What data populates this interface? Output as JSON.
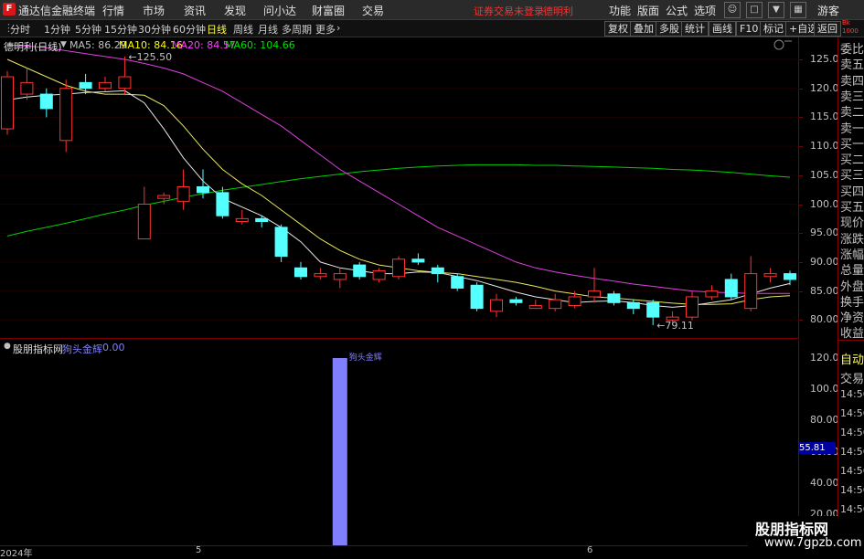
{
  "titlebar": {
    "logo": "F",
    "app_title": "通达信金融终端",
    "menus": [
      "行情",
      "市场",
      "资讯",
      "发现",
      "问小达",
      "财富圈",
      "交易"
    ],
    "login_notice": "证券交易未登录",
    "stock_name": "德明利",
    "right_menus": [
      "功能",
      "版面",
      "公式",
      "选项"
    ],
    "guest": "游客"
  },
  "toolbar": {
    "periods": [
      "分时",
      "1分钟",
      "5分钟",
      "15分钟",
      "30分钟",
      "60分钟",
      "日线",
      "周线",
      "月线",
      "多周期",
      "更多"
    ],
    "active_period": "日线",
    "buttons": [
      "复权",
      "叠加",
      "多股",
      "统计",
      "画线",
      "F10",
      "标记",
      "+自选",
      "返回"
    ]
  },
  "main_chart": {
    "title": "德明利(日线)",
    "ma_labels": [
      {
        "text": "MA5: 86.29",
        "color": "#ffffff"
      },
      {
        "text": "MA10: 84.16",
        "color": "#ffff00"
      },
      {
        "text": "MA20: 84.57",
        "color": "#ff40ff"
      },
      {
        "text": "MA60: 104.66",
        "color": "#00e000"
      }
    ],
    "high_label": "125.50",
    "low_label": "79.11",
    "y_ticks": [
      "125.0",
      "120.0",
      "115.0",
      "110.0",
      "105.0",
      "100.0",
      "95.00",
      "90.00",
      "85.00",
      "80.00"
    ]
  },
  "chart_data": {
    "type": "candlestick",
    "ylim": [
      78,
      128
    ],
    "candles": [
      {
        "o": 113.0,
        "c": 122.0,
        "h": 123.0,
        "l": 112.0
      },
      {
        "o": 119.0,
        "c": 121.0,
        "h": 123.5,
        "l": 118.0
      },
      {
        "o": 119.0,
        "c": 116.5,
        "h": 120.0,
        "l": 115.0
      },
      {
        "o": 111.0,
        "c": 120.0,
        "h": 121.5,
        "l": 109.0
      },
      {
        "o": 121.0,
        "c": 120.0,
        "h": 122.5,
        "l": 119.0
      },
      {
        "o": 120.0,
        "c": 121.0,
        "h": 122.0,
        "l": 119.5
      },
      {
        "o": 120.0,
        "c": 122.0,
        "h": 125.5,
        "l": 119.0
      },
      {
        "o": 94.0,
        "c": 100.0,
        "h": 103.0,
        "l": 94.0
      },
      {
        "o": 101.0,
        "c": 101.5,
        "h": 102.0,
        "l": 100.0
      },
      {
        "o": 100.5,
        "c": 103.0,
        "h": 106.0,
        "l": 99.0
      },
      {
        "o": 103.0,
        "c": 102.0,
        "h": 106.0,
        "l": 101.0
      },
      {
        "o": 102.0,
        "c": 98.0,
        "h": 103.0,
        "l": 97.5
      },
      {
        "o": 97.0,
        "c": 97.5,
        "h": 99.0,
        "l": 96.5
      },
      {
        "o": 97.5,
        "c": 97.0,
        "h": 98.0,
        "l": 96.0
      },
      {
        "o": 96.0,
        "c": 91.0,
        "h": 96.5,
        "l": 90.0
      },
      {
        "o": 89.0,
        "c": 87.5,
        "h": 90.0,
        "l": 87.0
      },
      {
        "o": 87.5,
        "c": 88.0,
        "h": 89.0,
        "l": 87.0
      },
      {
        "o": 87.0,
        "c": 88.0,
        "h": 89.0,
        "l": 85.5
      },
      {
        "o": 89.5,
        "c": 87.5,
        "h": 90.0,
        "l": 87.0
      },
      {
        "o": 87.0,
        "c": 88.5,
        "h": 89.0,
        "l": 86.5
      },
      {
        "o": 87.5,
        "c": 90.5,
        "h": 91.0,
        "l": 87.0
      },
      {
        "o": 90.5,
        "c": 90.0,
        "h": 91.5,
        "l": 89.5
      },
      {
        "o": 89.0,
        "c": 88.0,
        "h": 89.5,
        "l": 86.5
      },
      {
        "o": 87.5,
        "c": 85.5,
        "h": 88.0,
        "l": 85.0
      },
      {
        "o": 86.0,
        "c": 82.0,
        "h": 86.5,
        "l": 81.5
      },
      {
        "o": 81.5,
        "c": 83.5,
        "h": 84.5,
        "l": 80.5
      },
      {
        "o": 83.5,
        "c": 83.0,
        "h": 84.0,
        "l": 82.5
      },
      {
        "o": 82.0,
        "c": 82.5,
        "h": 83.5,
        "l": 82.0
      },
      {
        "o": 82.0,
        "c": 83.5,
        "h": 84.5,
        "l": 81.5
      },
      {
        "o": 82.5,
        "c": 84.0,
        "h": 85.0,
        "l": 82.0
      },
      {
        "o": 84.0,
        "c": 85.0,
        "h": 89.0,
        "l": 83.0
      },
      {
        "o": 84.5,
        "c": 83.0,
        "h": 85.0,
        "l": 82.5
      },
      {
        "o": 83.0,
        "c": 82.0,
        "h": 83.5,
        "l": 81.0
      },
      {
        "o": 83.0,
        "c": 80.5,
        "h": 83.5,
        "l": 79.11
      },
      {
        "o": 80.0,
        "c": 80.5,
        "h": 81.5,
        "l": 79.5
      },
      {
        "o": 80.5,
        "c": 84.0,
        "h": 85.0,
        "l": 80.0
      },
      {
        "o": 84.0,
        "c": 85.0,
        "h": 86.0,
        "l": 83.5
      },
      {
        "o": 87.0,
        "c": 84.0,
        "h": 88.0,
        "l": 83.5
      },
      {
        "o": 82.0,
        "c": 88.0,
        "h": 91.0,
        "l": 81.5
      },
      {
        "o": 87.5,
        "c": 88.0,
        "h": 89.0,
        "l": 86.5
      },
      {
        "o": 88.0,
        "c": 87.0,
        "h": 88.5,
        "l": 86.0
      }
    ],
    "ma5": [
      118.0,
      118.5,
      118.8,
      119.0,
      119.3,
      119.4,
      119.6,
      117.5,
      113.0,
      108.0,
      104.0,
      101.0,
      99.5,
      98.0,
      96.0,
      93.5,
      90.0,
      89.0,
      88.5,
      88.0,
      88.0,
      88.3,
      88.2,
      87.5,
      86.8,
      85.8,
      84.8,
      84.0,
      83.5,
      83.0,
      83.2,
      83.3,
      83.0,
      82.5,
      82.2,
      82.5,
      83.0,
      83.5,
      84.5,
      85.5,
      86.3
    ],
    "ma10": [
      125.0,
      123.5,
      122.0,
      120.5,
      119.5,
      119.0,
      119.0,
      118.8,
      117.0,
      113.5,
      109.5,
      106.0,
      103.5,
      101.5,
      99.0,
      96.5,
      94.0,
      92.0,
      90.5,
      89.5,
      89.0,
      88.5,
      88.2,
      88.0,
      87.5,
      87.0,
      86.5,
      85.8,
      85.0,
      84.5,
      84.0,
      83.8,
      83.5,
      83.2,
      82.9,
      82.7,
      82.7,
      82.8,
      83.5,
      84.0,
      84.2
    ],
    "ma20": [
      127.5,
      127.3,
      127.0,
      126.5,
      126.0,
      125.5,
      125.0,
      124.3,
      123.5,
      122.5,
      121.0,
      119.5,
      117.5,
      115.5,
      113.5,
      111.0,
      108.5,
      106.0,
      104.0,
      102.0,
      100.0,
      98.0,
      96.0,
      94.5,
      93.0,
      91.5,
      90.0,
      89.0,
      88.3,
      87.7,
      87.2,
      86.7,
      86.2,
      85.8,
      85.4,
      85.0,
      84.8,
      84.7,
      84.6,
      84.6,
      84.6
    ],
    "ma60": [
      94.5,
      95.3,
      96.0,
      96.7,
      97.5,
      98.3,
      99.0,
      99.8,
      100.5,
      101.2,
      101.8,
      102.4,
      102.9,
      103.4,
      103.9,
      104.4,
      104.8,
      105.2,
      105.6,
      105.9,
      106.2,
      106.4,
      106.6,
      106.7,
      106.8,
      106.8,
      106.8,
      106.7,
      106.7,
      106.6,
      106.5,
      106.4,
      106.3,
      106.2,
      106.0,
      105.9,
      105.7,
      105.5,
      105.2,
      104.9,
      104.66
    ]
  },
  "indicator": {
    "title": "股朋指标网",
    "name": "狗头金辉",
    "value": "0.00",
    "bar_label": "狗头金辉",
    "bar_value": 120.0,
    "bar_index": 17,
    "y_ticks": [
      "120.0",
      "100.0",
      "80.00",
      "60.00",
      "40.00",
      "20.00"
    ],
    "current_value": "55.81"
  },
  "xaxis": {
    "labels": [
      {
        "text": "2024年",
        "index": 0
      },
      {
        "text": "5",
        "index": 10
      },
      {
        "text": "6",
        "index": 30
      }
    ]
  },
  "right_panel": {
    "labels": [
      "委比",
      "卖五",
      "卖四",
      "卖三",
      "卖二",
      "卖一",
      "买一",
      "买二",
      "买三",
      "买四",
      "买五",
      "现价",
      "涨跌",
      "涨幅",
      "总量",
      "外盘",
      "换手",
      "净资",
      "收益"
    ],
    "indicator_labels": [
      "自动",
      "交易",
      "14:56",
      "14:56",
      "14:56",
      "14:56",
      "14:56",
      "14:56",
      "14:56",
      "14:56"
    ],
    "top_badge": "Bk 1000"
  },
  "watermark": {
    "line1": "股朋指标网",
    "line2": "www.7gpzb.com"
  }
}
